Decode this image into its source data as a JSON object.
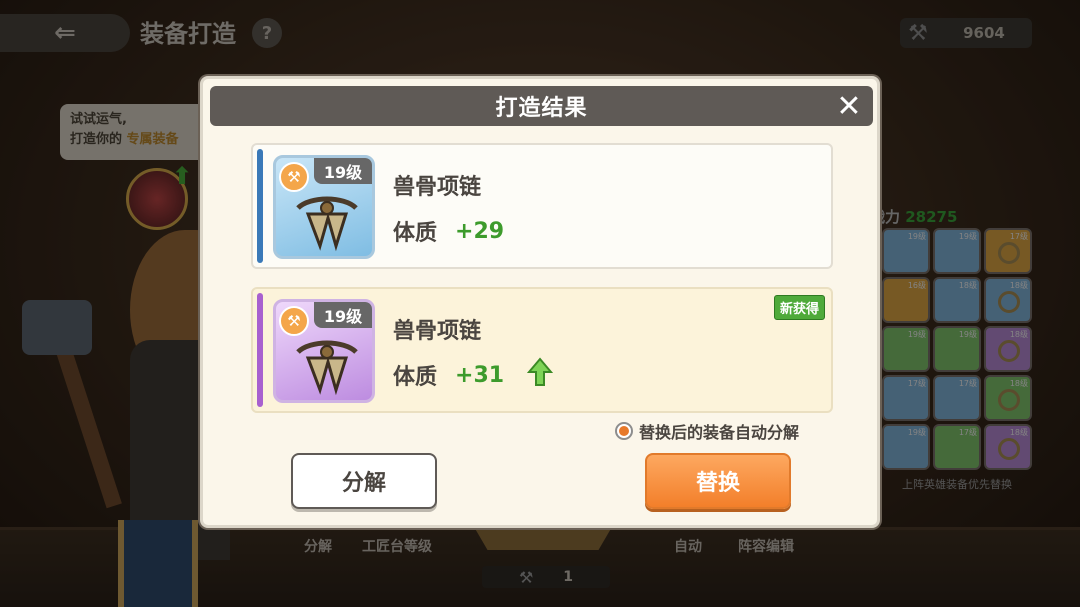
{
  "background": {
    "header_title": "装备打造",
    "help_label": "?",
    "currency_value": "9604",
    "hint_line1": "试试运气,",
    "hint_line2_prefix": "打造你的",
    "hint_line2_highlight": "专属装备",
    "power_label": "战力",
    "power_value": "28275",
    "grid_note": "上阵英雄装备优先替换",
    "bottom_labels": [
      "分解",
      "工匠台等级",
      "自动",
      "阵容编辑"
    ],
    "count_value": "1",
    "grid_levels": [
      "19级",
      "19级",
      "17级",
      "16级",
      "18级",
      "18级",
      "19级",
      "19级",
      "18级",
      "17级",
      "17级",
      "18级",
      "19级",
      "17级",
      "18级"
    ]
  },
  "modal": {
    "title": "打造结果",
    "close_icon": "close-icon",
    "current": {
      "level": "19级",
      "name": "兽骨项链",
      "stat_label": "体质",
      "stat_value": "+29",
      "rarity_color": "#3a79b8"
    },
    "result": {
      "level": "19级",
      "name": "兽骨项链",
      "stat_label": "体质",
      "stat_value": "+31",
      "new_label": "新获得",
      "rarity_color": "#a860cf"
    },
    "auto_salvage_label": "替换后的装备自动分解",
    "auto_salvage_checked": true,
    "salvage_button": "分解",
    "replace_button": "替换"
  },
  "colors": {
    "stat_green": "#3d9b2c",
    "replace_orange": "#f37f2a",
    "header_gray": "#5f5a56"
  }
}
